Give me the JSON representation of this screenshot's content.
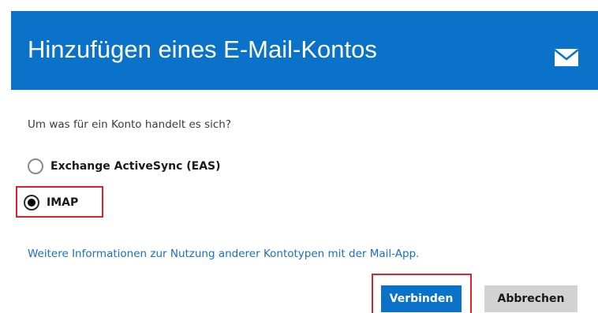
{
  "header": {
    "title": "Hinzufügen eines E-Mail-Kontos",
    "icon": "envelope-icon",
    "background_color": "#0a73c9"
  },
  "form": {
    "question": "Um was für ein Konto handelt es sich?",
    "options": [
      {
        "label": "Exchange ActiveSync (EAS)",
        "selected": false
      },
      {
        "label": "IMAP",
        "selected": true
      }
    ],
    "more_info_link": "Weitere Informationen zur Nutzung anderer Kontotypen mit der Mail-App."
  },
  "buttons": {
    "connect_label": "Verbinden",
    "cancel_label": "Abbrechen"
  },
  "highlight_color": "#d8242b"
}
